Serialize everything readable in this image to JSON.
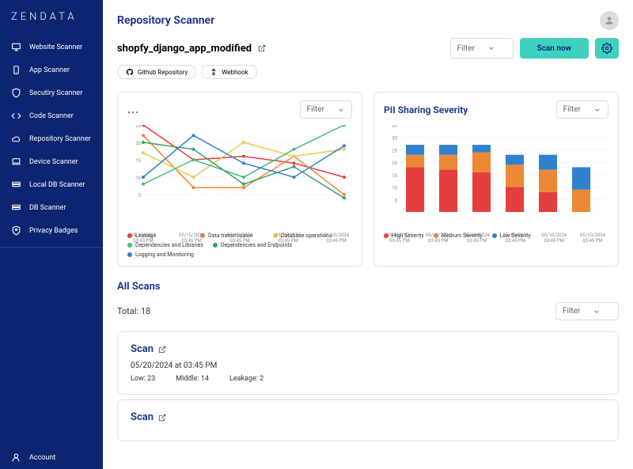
{
  "brand": "ZENDATA",
  "sidebar": {
    "items": [
      {
        "label": "Website Scanner",
        "icon": "monitor"
      },
      {
        "label": "App Scanner",
        "icon": "phone"
      },
      {
        "label": "Secutiry Scanner",
        "icon": "shield"
      },
      {
        "label": "Code Scanner",
        "icon": "code"
      },
      {
        "label": "Repository Scanner",
        "icon": "cloud"
      },
      {
        "label": "Device Scanner",
        "icon": "laptop"
      },
      {
        "label": "Local DB Scanner",
        "icon": "db"
      },
      {
        "label": "DB Scanner",
        "icon": "db"
      },
      {
        "label": "Privacy Badges",
        "icon": "badge"
      }
    ],
    "account_label": "Account"
  },
  "page_title": "Repository Scanner",
  "repo_name": "shopfy_django_app_modified",
  "filter_label": "Filter",
  "scan_now_label": "Scan now",
  "chips": [
    {
      "label": "Github Repository"
    },
    {
      "label": "Webhook"
    }
  ],
  "chart1": {
    "menu_icon": "...",
    "legend": [
      {
        "label": "Leakage",
        "color": "#e53e3e"
      },
      {
        "label": "Data transmission",
        "color": "#ed8936"
      },
      {
        "label": "Database operations",
        "color": "#ecc94b"
      },
      {
        "label": "Dependencies and Libraries",
        "color": "#48bb78"
      },
      {
        "label": "Dependencies and Endpoints",
        "color": "#38a169"
      },
      {
        "label": "Logging and Monitoring",
        "color": "#3182ce"
      }
    ],
    "x_labels": [
      "05/10/2024 03:45 PM",
      "05/15/2024 03:45 PM",
      "05/20/2024 03:45 PM",
      "05/25/2024 03:45 PM",
      "05/20/2024 03:45 PM"
    ]
  },
  "chart2": {
    "title": "PII Sharing Severity",
    "legend": [
      {
        "label": "High Severity",
        "color": "#e53e3e"
      },
      {
        "label": "Medium Severity",
        "color": "#ed8936"
      },
      {
        "label": "Low Severity",
        "color": "#3182ce"
      }
    ],
    "x_labels": [
      "05/10/2024 03:45 PM",
      "05/10/2024 03:45 PM",
      "05/10/2024 03:45 PM",
      "05/10/2024 03:45 PM",
      "05/10/2024 03:45 PM",
      "05/10/2024 03:45 PM"
    ]
  },
  "all_scans_title": "All Scans",
  "total_label": "Total: 18",
  "scans": [
    {
      "title": "Scan",
      "date": "05/20/2024 at 03:45 PM",
      "low": "Low: 23",
      "middle": "Middle: 14",
      "leakage": "Leakage: 2"
    },
    {
      "title": "Scan"
    }
  ],
  "chart_data": [
    {
      "type": "line",
      "title": "",
      "ylim": [
        0,
        25
      ],
      "y_ticks": [
        25,
        20,
        15,
        10,
        5
      ],
      "categories": [
        "05/10/2024 03:45 PM",
        "05/15/2024 03:45 PM",
        "05/20/2024 03:45 PM",
        "05/25/2024 03:45 PM",
        "05/20/2024 03:45 PM"
      ],
      "series": [
        {
          "name": "Leakage",
          "color": "#e53e3e",
          "values": [
            25,
            15,
            16,
            14,
            10
          ]
        },
        {
          "name": "Data transmission",
          "color": "#ed8936",
          "values": [
            22,
            7,
            7,
            16,
            5
          ]
        },
        {
          "name": "Database operations",
          "color": "#ecc94b",
          "values": [
            17,
            10,
            20,
            16,
            18
          ]
        },
        {
          "name": "Dependencies and Libraries",
          "color": "#48bb78",
          "values": [
            8,
            15,
            10,
            18,
            25
          ]
        },
        {
          "name": "Dependencies and Endpoints",
          "color": "#38a169",
          "values": [
            20,
            18,
            8,
            13,
            4
          ]
        },
        {
          "name": "Logging and Monitoring",
          "color": "#3182ce",
          "values": [
            10,
            22,
            14,
            10,
            19
          ]
        }
      ]
    },
    {
      "type": "bar",
      "title": "PII Sharing Severity",
      "ylim": [
        0,
        35
      ],
      "y_ticks": [
        35,
        30,
        25,
        20,
        15,
        10,
        5
      ],
      "categories": [
        "05/10/2024 03:45 PM",
        "05/10/2024 03:45 PM",
        "05/10/2024 03:45 PM",
        "05/10/2024 03:45 PM",
        "05/10/2024 03:45 PM",
        "05/10/2024 03:45 PM"
      ],
      "series": [
        {
          "name": "High Severity",
          "color": "#e53e3e",
          "values": [
            18,
            17,
            16,
            10,
            8,
            0
          ]
        },
        {
          "name": "Medium Severity",
          "color": "#ed8936",
          "values": [
            5,
            6,
            8,
            9,
            9,
            9
          ]
        },
        {
          "name": "Low Severity",
          "color": "#3182ce",
          "values": [
            4,
            4,
            3,
            4,
            6,
            9
          ]
        }
      ]
    }
  ]
}
